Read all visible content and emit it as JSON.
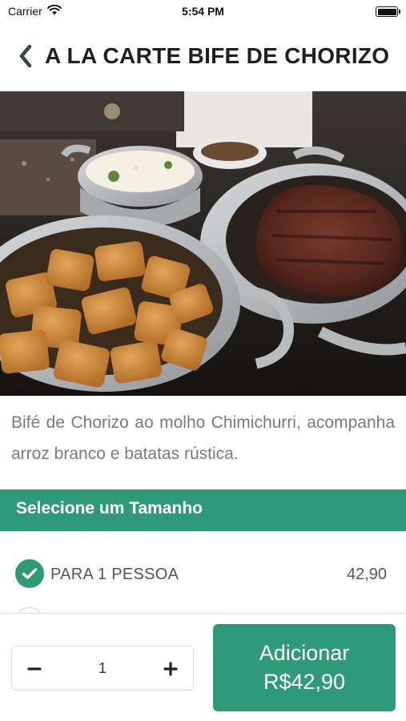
{
  "status_bar": {
    "carrier": "Carrier",
    "time": "5:54 PM"
  },
  "nav": {
    "title": "A LA CARTE BIFE DE CHORIZO"
  },
  "product": {
    "description": "Bifé de Chorizo ao molho Chimichurri, acompanha arroz branco e batatas rústica."
  },
  "size_section": {
    "title": "Selecione um Tamanho",
    "options": [
      {
        "label": "PARA 1 PESSOA",
        "price": "42,90",
        "selected": true
      }
    ]
  },
  "footer": {
    "quantity": "1",
    "add_label": "Adicionar",
    "add_price": "R$42,90"
  },
  "colors": {
    "accent": "#2f9a78",
    "text_primary": "#1f1f1f",
    "text_secondary": "#7a7a7a"
  },
  "icons": [
    "wifi-icon",
    "battery-icon",
    "chevron-left-icon",
    "check-icon",
    "minus-icon",
    "plus-icon"
  ]
}
